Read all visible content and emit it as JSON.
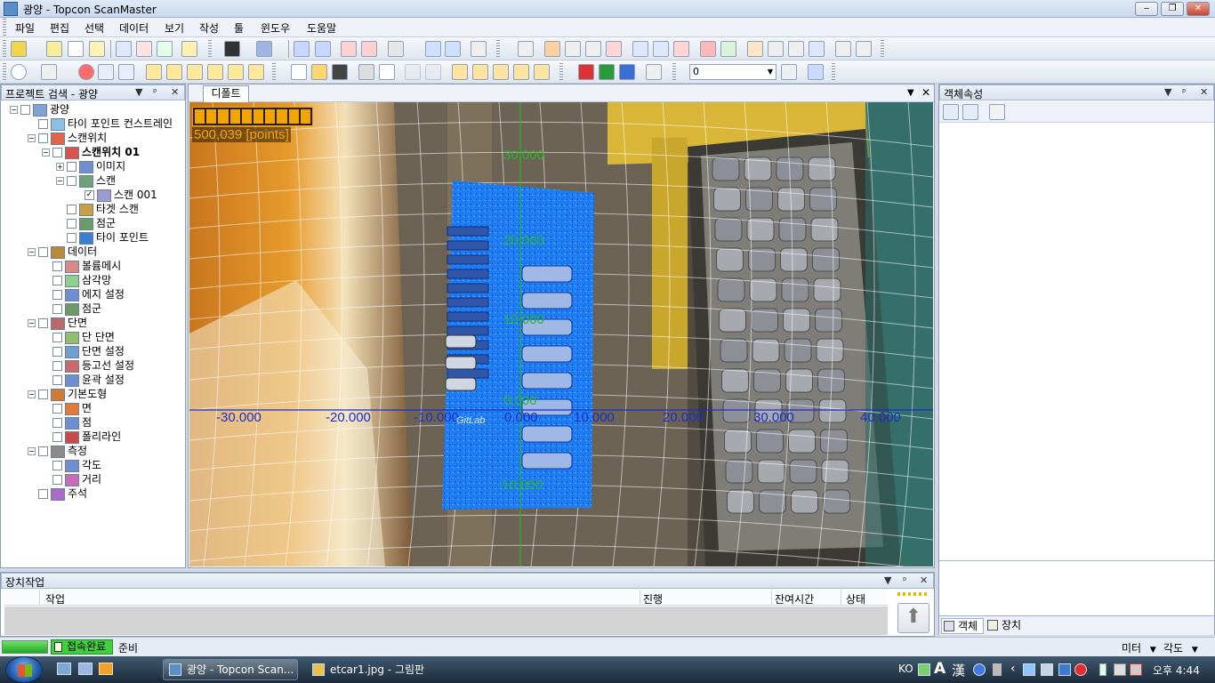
{
  "window": {
    "title": "광양 - Topcon ScanMaster",
    "minimize": "‒",
    "restore": "❐",
    "close": "✕"
  },
  "menu": [
    "파일",
    "편집",
    "선택",
    "데이터",
    "보기",
    "작성",
    "툴",
    "윈도우",
    "도움말"
  ],
  "toolbar": {
    "value_field": "0"
  },
  "project_panel": {
    "title": "프로젝트 검색 - 광양",
    "tree": [
      {
        "label": "광양",
        "level": 0,
        "bold": false
      },
      {
        "label": "타이 포인트 컨스트레인",
        "level": 1
      },
      {
        "label": "스캔위치",
        "level": 1
      },
      {
        "label": "스캔위치 01",
        "level": 2,
        "bold": true
      },
      {
        "label": "이미지",
        "level": 3
      },
      {
        "label": "스캔",
        "level": 3
      },
      {
        "label": "스캔 001",
        "level": 4,
        "checked": true
      },
      {
        "label": "타겟 스캔",
        "level": 3
      },
      {
        "label": "점군",
        "level": 3
      },
      {
        "label": "타이 포인트",
        "level": 3
      },
      {
        "label": "데이터",
        "level": 1
      },
      {
        "label": "볼륨메시",
        "level": 2
      },
      {
        "label": "삼각망",
        "level": 2
      },
      {
        "label": "에지 설정",
        "level": 2
      },
      {
        "label": "점군",
        "level": 2
      },
      {
        "label": "단면",
        "level": 1
      },
      {
        "label": "단 단면",
        "level": 2
      },
      {
        "label": "단면 설정",
        "level": 2
      },
      {
        "label": "등고선 설정",
        "level": 2
      },
      {
        "label": "윤곽 설정",
        "level": 2
      },
      {
        "label": "기본도형",
        "level": 1
      },
      {
        "label": "면",
        "level": 2
      },
      {
        "label": "점",
        "level": 2
      },
      {
        "label": "폴리라인",
        "level": 2
      },
      {
        "label": "측정",
        "level": 1
      },
      {
        "label": "각도",
        "level": 2
      },
      {
        "label": "거리",
        "level": 2
      },
      {
        "label": "주석",
        "level": 1
      }
    ]
  },
  "view": {
    "tab": "디폴트",
    "point_count": "500,039 [points]",
    "x_labels": [
      "-30.000",
      "-20.000",
      "-10.000",
      "0.000",
      "10.000",
      "20.000",
      "30.000",
      "40.000"
    ],
    "y_labels": [
      "30.000",
      "20.000",
      "10.000",
      "0.000",
      "-10.000"
    ],
    "scan_tag": "GitLab"
  },
  "properties_panel": {
    "title": "객체속성",
    "tabs": [
      "객체",
      "장치"
    ]
  },
  "device_panel": {
    "title": "장치작업",
    "columns": [
      "작업",
      "진행",
      "잔여시간",
      "상태"
    ]
  },
  "status": {
    "connection": "접속완료",
    "state": "준비",
    "unit": "미터",
    "angle": "각도"
  },
  "taskbar": {
    "tasks": [
      "광양 - Topcon Scan...",
      "etcar1.jpg - 그림판"
    ],
    "lang": "KO",
    "tray_a": "A",
    "tray_han": "漢",
    "clock": "오후 4:44"
  },
  "colors": {
    "accent": "#2a63b8",
    "point_blue": "#1b7cf5",
    "grid_blue": "#1a2fc9",
    "axis_green": "#2bb52b",
    "progress_orange": "#f0a500"
  }
}
